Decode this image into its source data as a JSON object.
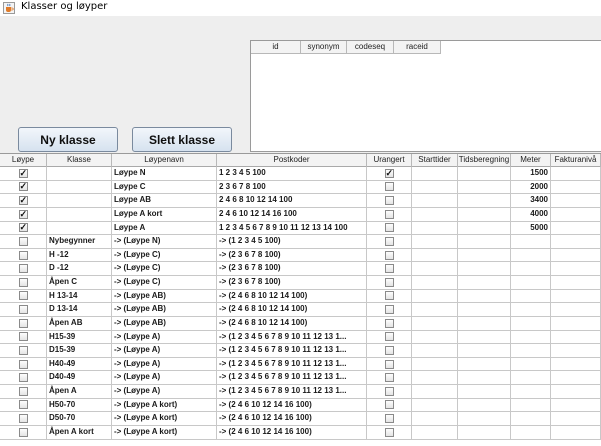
{
  "window": {
    "title": "Klasser og løyper",
    "app_icon": "java-cup-icon"
  },
  "buttons": {
    "new_class": "Ny klasse",
    "delete_class": "Slett klasse"
  },
  "small_table": {
    "columns": [
      "id",
      "synonym",
      "codeseq",
      "raceid"
    ]
  },
  "main_table": {
    "columns": [
      "Løype",
      "Klasse",
      "Løypenavn",
      "Postkoder",
      "Urangert",
      "Starttider",
      "Tidsberegning",
      "Meter",
      "Fakturanivå"
    ],
    "rows": [
      {
        "loype": true,
        "klasse": "",
        "loypenavn": "Løype N",
        "postkoder": "1 2 3 4 5 100",
        "urangert": true,
        "starttider": "",
        "tidsberegning": "",
        "meter": "1500",
        "fakturaniva": ""
      },
      {
        "loype": true,
        "klasse": "",
        "loypenavn": "Løype C",
        "postkoder": "2 3 6 7 8 100",
        "urangert": false,
        "starttider": "",
        "tidsberegning": "",
        "meter": "2000",
        "fakturaniva": ""
      },
      {
        "loype": true,
        "klasse": "",
        "loypenavn": "Løype AB",
        "postkoder": "2 4 6 8 10 12 14 100",
        "urangert": false,
        "starttider": "",
        "tidsberegning": "",
        "meter": "3400",
        "fakturaniva": ""
      },
      {
        "loype": true,
        "klasse": "",
        "loypenavn": "Løype A kort",
        "postkoder": "2 4 6 10 12 14 16 100",
        "urangert": false,
        "starttider": "",
        "tidsberegning": "",
        "meter": "4000",
        "fakturaniva": ""
      },
      {
        "loype": true,
        "klasse": "",
        "loypenavn": "Løype A",
        "postkoder": "1 2 3 4 5 6 7 8 9 10 11 12 13 14 100",
        "urangert": false,
        "starttider": "",
        "tidsberegning": "",
        "meter": "5000",
        "fakturaniva": ""
      },
      {
        "loype": false,
        "klasse": "Nybegynner",
        "loypenavn": "-> (Løype N)",
        "postkoder": "-> (1 2 3 4 5 100)",
        "urangert": false,
        "starttider": "",
        "tidsberegning": "",
        "meter": "",
        "fakturaniva": ""
      },
      {
        "loype": false,
        "klasse": "H -12",
        "loypenavn": "-> (Løype C)",
        "postkoder": "-> (2 3 6 7 8 100)",
        "urangert": false,
        "starttider": "",
        "tidsberegning": "",
        "meter": "",
        "fakturaniva": ""
      },
      {
        "loype": false,
        "klasse": "D -12",
        "loypenavn": "-> (Løype C)",
        "postkoder": "-> (2 3 6 7 8 100)",
        "urangert": false,
        "starttider": "",
        "tidsberegning": "",
        "meter": "",
        "fakturaniva": ""
      },
      {
        "loype": false,
        "klasse": "Åpen C",
        "loypenavn": "-> (Løype C)",
        "postkoder": "-> (2 3 6 7 8 100)",
        "urangert": false,
        "starttider": "",
        "tidsberegning": "",
        "meter": "",
        "fakturaniva": ""
      },
      {
        "loype": false,
        "klasse": "H 13-14",
        "loypenavn": "-> (Løype AB)",
        "postkoder": "-> (2 4 6 8 10 12 14 100)",
        "urangert": false,
        "starttider": "",
        "tidsberegning": "",
        "meter": "",
        "fakturaniva": ""
      },
      {
        "loype": false,
        "klasse": "D 13-14",
        "loypenavn": "-> (Løype AB)",
        "postkoder": "-> (2 4 6 8 10 12 14 100)",
        "urangert": false,
        "starttider": "",
        "tidsberegning": "",
        "meter": "",
        "fakturaniva": ""
      },
      {
        "loype": false,
        "klasse": "Åpen AB",
        "loypenavn": "-> (Løype AB)",
        "postkoder": "-> (2 4 6 8 10 12 14 100)",
        "urangert": false,
        "starttider": "",
        "tidsberegning": "",
        "meter": "",
        "fakturaniva": ""
      },
      {
        "loype": false,
        "klasse": "H15-39",
        "loypenavn": "-> (Løype A)",
        "postkoder": "-> (1 2 3 4 5 6 7 8 9 10 11 12 13 1...",
        "urangert": false,
        "starttider": "",
        "tidsberegning": "",
        "meter": "",
        "fakturaniva": ""
      },
      {
        "loype": false,
        "klasse": "D15-39",
        "loypenavn": "-> (Løype A)",
        "postkoder": "-> (1 2 3 4 5 6 7 8 9 10 11 12 13 1...",
        "urangert": false,
        "starttider": "",
        "tidsberegning": "",
        "meter": "",
        "fakturaniva": ""
      },
      {
        "loype": false,
        "klasse": "H40-49",
        "loypenavn": "-> (Løype A)",
        "postkoder": "-> (1 2 3 4 5 6 7 8 9 10 11 12 13 1...",
        "urangert": false,
        "starttider": "",
        "tidsberegning": "",
        "meter": "",
        "fakturaniva": ""
      },
      {
        "loype": false,
        "klasse": "D40-49",
        "loypenavn": "-> (Løype A)",
        "postkoder": "-> (1 2 3 4 5 6 7 8 9 10 11 12 13 1...",
        "urangert": false,
        "starttider": "",
        "tidsberegning": "",
        "meter": "",
        "fakturaniva": ""
      },
      {
        "loype": false,
        "klasse": "Åpen A",
        "loypenavn": "-> (Løype A)",
        "postkoder": "-> (1 2 3 4 5 6 7 8 9 10 11 12 13 1...",
        "urangert": false,
        "starttider": "",
        "tidsberegning": "",
        "meter": "",
        "fakturaniva": ""
      },
      {
        "loype": false,
        "klasse": "H50-70",
        "loypenavn": "-> (Løype A kort)",
        "postkoder": "-> (2 4 6 10 12 14 16 100)",
        "urangert": false,
        "starttider": "",
        "tidsberegning": "",
        "meter": "",
        "fakturaniva": ""
      },
      {
        "loype": false,
        "klasse": "D50-70",
        "loypenavn": "-> (Løype A kort)",
        "postkoder": "-> (2 4 6 10 12 14 16 100)",
        "urangert": false,
        "starttider": "",
        "tidsberegning": "",
        "meter": "",
        "fakturaniva": ""
      },
      {
        "loype": false,
        "klasse": "Åpen A kort",
        "loypenavn": "-> (Løype A kort)",
        "postkoder": "-> (2 4 6 10 12 14 16 100)",
        "urangert": false,
        "starttider": "",
        "tidsberegning": "",
        "meter": "",
        "fakturaniva": ""
      }
    ]
  }
}
